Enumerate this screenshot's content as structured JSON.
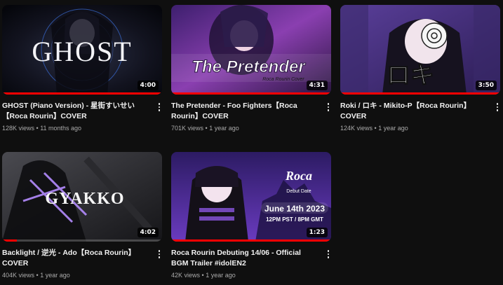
{
  "videos": [
    {
      "title": "GHOST (Piano Version) - 星街すいせい【Roca Rourin】COVER",
      "views": "128K views",
      "age": "11 months ago",
      "duration": "4:00",
      "thumb_text": "GHOST",
      "watched_fraction": 1.0
    },
    {
      "title": "The Pretender - Foo Fighters【Roca Rourin】COVER",
      "views": "701K views",
      "age": "1 year ago",
      "duration": "4:31",
      "thumb_text": "The Pretender",
      "thumb_subtext": "Roca Rourin Cover",
      "watched_fraction": 1.0
    },
    {
      "title": "Roki / ロキ - Mikito-P【Roca Rourin】COVER",
      "views": "124K views",
      "age": "1 year ago",
      "duration": "3:50",
      "thumb_text": "ロキ",
      "watched_fraction": 1.0
    },
    {
      "title": "Backlight / 逆光 - Ado【Roca Rourin】COVER",
      "views": "404K views",
      "age": "1 year ago",
      "duration": "4:02",
      "thumb_text": "GYAKKO",
      "watched_fraction": 0.09
    },
    {
      "title": "Roca Rourin Debuting 14/06 - Official BGM Trailer #idolEN2",
      "views": "42K views",
      "age": "1 year ago",
      "duration": "1:23",
      "thumb_text": "June 14th 2023",
      "thumb_subtext": "12PM PST / 8PM GMT",
      "thumb_logo": "Roca",
      "thumb_logo_sub": "Debut Date",
      "watched_fraction": 1.0
    }
  ],
  "separator": " • ",
  "colors": {
    "background": "#0f0f0f",
    "title": "#f1f1f1",
    "secondary_text": "#aaaaaa",
    "progress": "#ff0000"
  },
  "icons": {
    "menu": "more-vertical-icon"
  }
}
